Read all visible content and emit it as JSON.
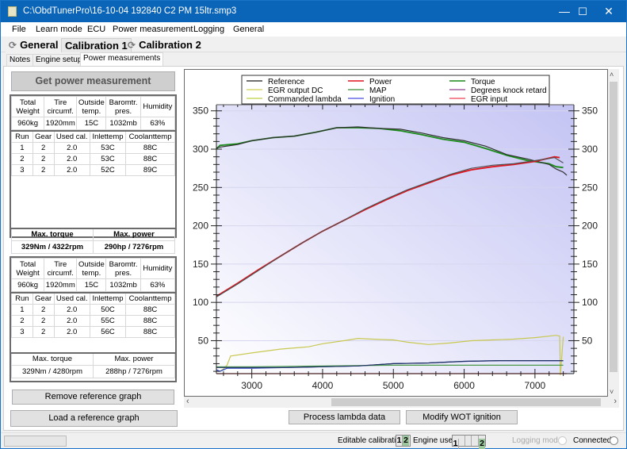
{
  "window": {
    "title": "C:\\ObdTunerPro\\16-10-04 192840 C2 PM 15ltr.smp3",
    "controls": {
      "minimize": "—",
      "maximize": "☐",
      "close": "✕"
    }
  },
  "menu": [
    "File",
    "Learn mode",
    "ECU",
    "Power measurement",
    "Logging",
    "General"
  ],
  "top_tabs": [
    {
      "label": "General",
      "icon": "refresh-icon"
    },
    {
      "label": "Calibration 1",
      "icon": ""
    },
    {
      "label": "Calibration 2",
      "icon": "refresh-icon"
    }
  ],
  "sub_tabs": [
    "Notes",
    "Engine setup",
    "Power measurements"
  ],
  "left": {
    "get_button": "Get power measurement",
    "measurement1": {
      "cond_headers": [
        "Total Weight",
        "Tire circumf.",
        "Outside temp.",
        "Baromtr. pres.",
        "Humidity"
      ],
      "cond_values": [
        "960kg",
        "1920mm",
        "15C",
        "1032mb",
        "63%"
      ],
      "run_headers": [
        "Run",
        "Gear",
        "Used cal.",
        "Inlettemp",
        "Coolanttemp"
      ],
      "runs": [
        [
          "1",
          "2",
          "2.0",
          "53C",
          "88C"
        ],
        [
          "2",
          "2",
          "2.0",
          "53C",
          "88C"
        ],
        [
          "3",
          "2",
          "2.0",
          "52C",
          "89C"
        ]
      ],
      "max_headers": [
        "Max. torque",
        "Max. power"
      ],
      "max_values": [
        "329Nm / 4322rpm",
        "290hp / 7276rpm"
      ]
    },
    "measurement2": {
      "cond_headers": [
        "Total Weight",
        "Tire circumf.",
        "Outside temp.",
        "Baromtr. pres.",
        "Humidity"
      ],
      "cond_values": [
        "960kg",
        "1920mm",
        "15C",
        "1032mb",
        "63%"
      ],
      "run_headers": [
        "Run",
        "Gear",
        "Used cal.",
        "Inlettemp",
        "Coolanttemp"
      ],
      "runs": [
        [
          "1",
          "2",
          "2.0",
          "50C",
          "88C"
        ],
        [
          "2",
          "2",
          "2.0",
          "55C",
          "88C"
        ],
        [
          "3",
          "2",
          "2.0",
          "56C",
          "88C"
        ]
      ],
      "max_headers": [
        "Max. torque",
        "Max. power"
      ],
      "max_values": [
        "329Nm / 4280rpm",
        "288hp / 7276rpm"
      ]
    },
    "remove_button": "Remove reference graph",
    "load_button": "Load a reference graph"
  },
  "bottom_buttons": {
    "process": "Process lambda data",
    "modify": "Modify WOT ignition"
  },
  "status": {
    "editable_label": "Editable calibration",
    "editable_slots": [
      "1",
      "2"
    ],
    "editable_active": "2",
    "engine_label": "Engine uses",
    "engine_slots": [
      "1",
      "",
      "",
      "2"
    ],
    "engine_active": "2",
    "logging_label": "Logging mode",
    "connected_label": "Connected"
  },
  "chart_data": {
    "type": "line",
    "title": "",
    "xlabel": "",
    "ylabel": "",
    "xlim": [
      2500,
      7550
    ],
    "ylim": [
      7,
      358
    ],
    "xticks": [
      3000,
      4000,
      5000,
      6000,
      7000
    ],
    "yticks": [
      50,
      100,
      150,
      200,
      250,
      300,
      350
    ],
    "grid": true,
    "legend_position": "top",
    "legend": [
      {
        "name": "Reference",
        "color": "#404040"
      },
      {
        "name": "Power",
        "color": "#e0141e"
      },
      {
        "name": "Torque",
        "color": "#1a8a1a"
      },
      {
        "name": "EGR output DC",
        "color": "#d8d870"
      },
      {
        "name": "MAP",
        "color": "#5aa05a"
      },
      {
        "name": "Degrees knock retard",
        "color": "#a060a0"
      },
      {
        "name": "Commanded lambda",
        "color": "#c8d860"
      },
      {
        "name": "Ignition",
        "color": "#6a6ae8"
      },
      {
        "name": "EGR input",
        "color": "#f06070"
      }
    ],
    "series": [
      {
        "name": "Torque",
        "color": "#1a8a1a",
        "x": [
          2500,
          2550,
          2800,
          3000,
          3300,
          3600,
          3900,
          4200,
          4500,
          4800,
          5100,
          5400,
          5700,
          6000,
          6300,
          6600,
          6900,
          7200,
          7300,
          7400
        ],
        "y": [
          300,
          305,
          307,
          311,
          315,
          317,
          322,
          328,
          328,
          327,
          324,
          319,
          313,
          309,
          301,
          292,
          285,
          281,
          277,
          276
        ]
      },
      {
        "name": "Reference torque",
        "color": "#303030",
        "x": [
          2500,
          2800,
          3000,
          3300,
          3600,
          3900,
          4200,
          4500,
          4800,
          5100,
          5400,
          5700,
          6000,
          6300,
          6600,
          6900,
          7200,
          7300,
          7400,
          7450
        ],
        "y": [
          302,
          306,
          311,
          315,
          317,
          322,
          328,
          329,
          327,
          326,
          321,
          315,
          311,
          304,
          293,
          287,
          280,
          274,
          270,
          266
        ]
      },
      {
        "name": "Power",
        "color": "#e0141e",
        "x": [
          2500,
          2800,
          3100,
          3400,
          3700,
          4000,
          4300,
          4600,
          4900,
          5200,
          5500,
          5800,
          6100,
          6400,
          6700,
          7000,
          7276,
          7350
        ],
        "y": [
          108,
          125,
          143,
          160,
          177,
          193,
          207,
          221,
          234,
          246,
          256,
          266,
          273,
          277,
          280,
          284,
          290,
          289
        ]
      },
      {
        "name": "Reference power",
        "color": "#505050",
        "x": [
          2500,
          2800,
          3100,
          3400,
          3700,
          4000,
          4300,
          4600,
          4900,
          5200,
          5500,
          5800,
          6100,
          6400,
          6700,
          7000,
          7276,
          7400
        ],
        "y": [
          107,
          124,
          142,
          160,
          177,
          193,
          207,
          222,
          235,
          247,
          257,
          267,
          275,
          279,
          281,
          285,
          289,
          282
        ]
      },
      {
        "name": "Commanded lambda",
        "color": "#c8c850",
        "x": [
          2550,
          2600,
          2650,
          2700,
          3000,
          3400,
          3800,
          4000,
          4300,
          4500,
          4700,
          5000,
          5200,
          5500,
          5800,
          6100,
          6400,
          6700,
          7000,
          7300,
          7350,
          7360,
          7400
        ],
        "y": [
          10,
          13,
          18,
          30,
          34,
          39,
          42,
          46,
          50,
          53,
          52,
          51,
          48,
          45,
          47,
          50,
          51,
          52,
          54,
          57,
          56,
          5,
          55
        ]
      },
      {
        "name": "Ignition",
        "color": "#2840c0",
        "x": [
          2500,
          2550,
          2650,
          3000,
          3500,
          4000,
          4500,
          5000,
          5500,
          6000,
          6500,
          7000,
          7400
        ],
        "y": [
          12,
          10,
          14,
          14,
          15,
          16,
          17,
          20,
          21,
          23,
          24,
          24,
          24
        ]
      },
      {
        "name": "MAP",
        "color": "#4a9a4a",
        "x": [
          2500,
          3000,
          4000,
          5000,
          6000,
          7000,
          7400
        ],
        "y": [
          16,
          16,
          17,
          18,
          18,
          18,
          18
        ]
      },
      {
        "name": "Reference ignition",
        "color": "#203060",
        "x": [
          2500,
          3000,
          3500,
          4000,
          4500,
          5000,
          5500,
          6000,
          6500,
          7000,
          7400
        ],
        "y": [
          15,
          15,
          15,
          16,
          17,
          20,
          21,
          23,
          24,
          24,
          24
        ]
      },
      {
        "name": "EGR input",
        "color": "#e0141e",
        "x": [
          2500,
          7450
        ],
        "y": [
          7,
          7
        ]
      }
    ]
  }
}
